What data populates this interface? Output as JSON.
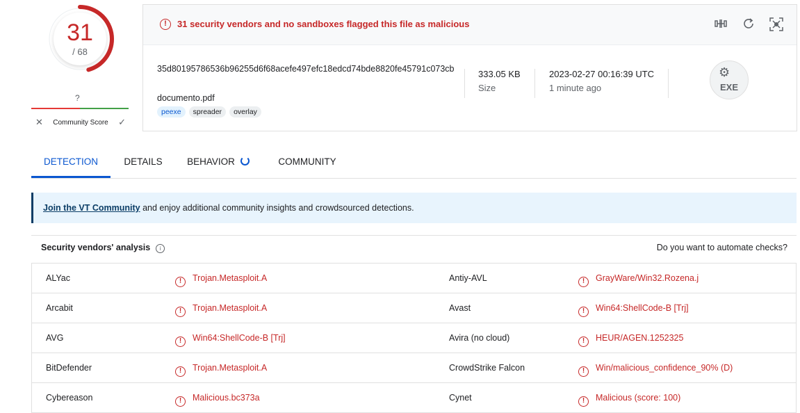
{
  "score": {
    "detected": "31",
    "total": "/ 68",
    "detected_fraction": 0.456,
    "color": "#c62828"
  },
  "community": {
    "question": "?",
    "label": "Community Score"
  },
  "header": {
    "alert": "31 security vendors and no sandboxes flagged this file as malicious",
    "icons": [
      "compare-icon",
      "reanalyze-icon",
      "similar-icon"
    ]
  },
  "file": {
    "hash": "35d80195786536b96255d6f68acefe497efc18edcd74bde8820fe45791c073cb",
    "name": "documento.pdf",
    "tags": [
      "peexe",
      "spreader",
      "overlay"
    ],
    "size_value": "333.05 KB",
    "size_label": "Size",
    "date_value": "2023-02-27 00:16:39 UTC",
    "date_label": "1 minute ago",
    "type_label": "EXE"
  },
  "tabs": [
    "DETECTION",
    "DETAILS",
    "BEHAVIOR",
    "COMMUNITY"
  ],
  "banner": {
    "link": "Join the VT Community",
    "text": " and enjoy additional community insights and crowdsourced detections."
  },
  "analysis": {
    "title": "Security vendors' analysis",
    "automate": "Do you want to automate checks?"
  },
  "rows": [
    {
      "v1": "ALYac",
      "r1": "Trojan.Metasploit.A",
      "v2": "Antiy-AVL",
      "r2": "GrayWare/Win32.Rozena.j"
    },
    {
      "v1": "Arcabit",
      "r1": "Trojan.Metasploit.A",
      "v2": "Avast",
      "r2": "Win64:ShellCode-B [Trj]"
    },
    {
      "v1": "AVG",
      "r1": "Win64:ShellCode-B [Trj]",
      "v2": "Avira (no cloud)",
      "r2": "HEUR/AGEN.1252325"
    },
    {
      "v1": "BitDefender",
      "r1": "Trojan.Metasploit.A",
      "v2": "CrowdStrike Falcon",
      "r2": "Win/malicious_confidence_90% (D)"
    },
    {
      "v1": "Cybereason",
      "r1": "Malicious.bc373a",
      "v2": "Cynet",
      "r2": "Malicious (score: 100)"
    }
  ]
}
